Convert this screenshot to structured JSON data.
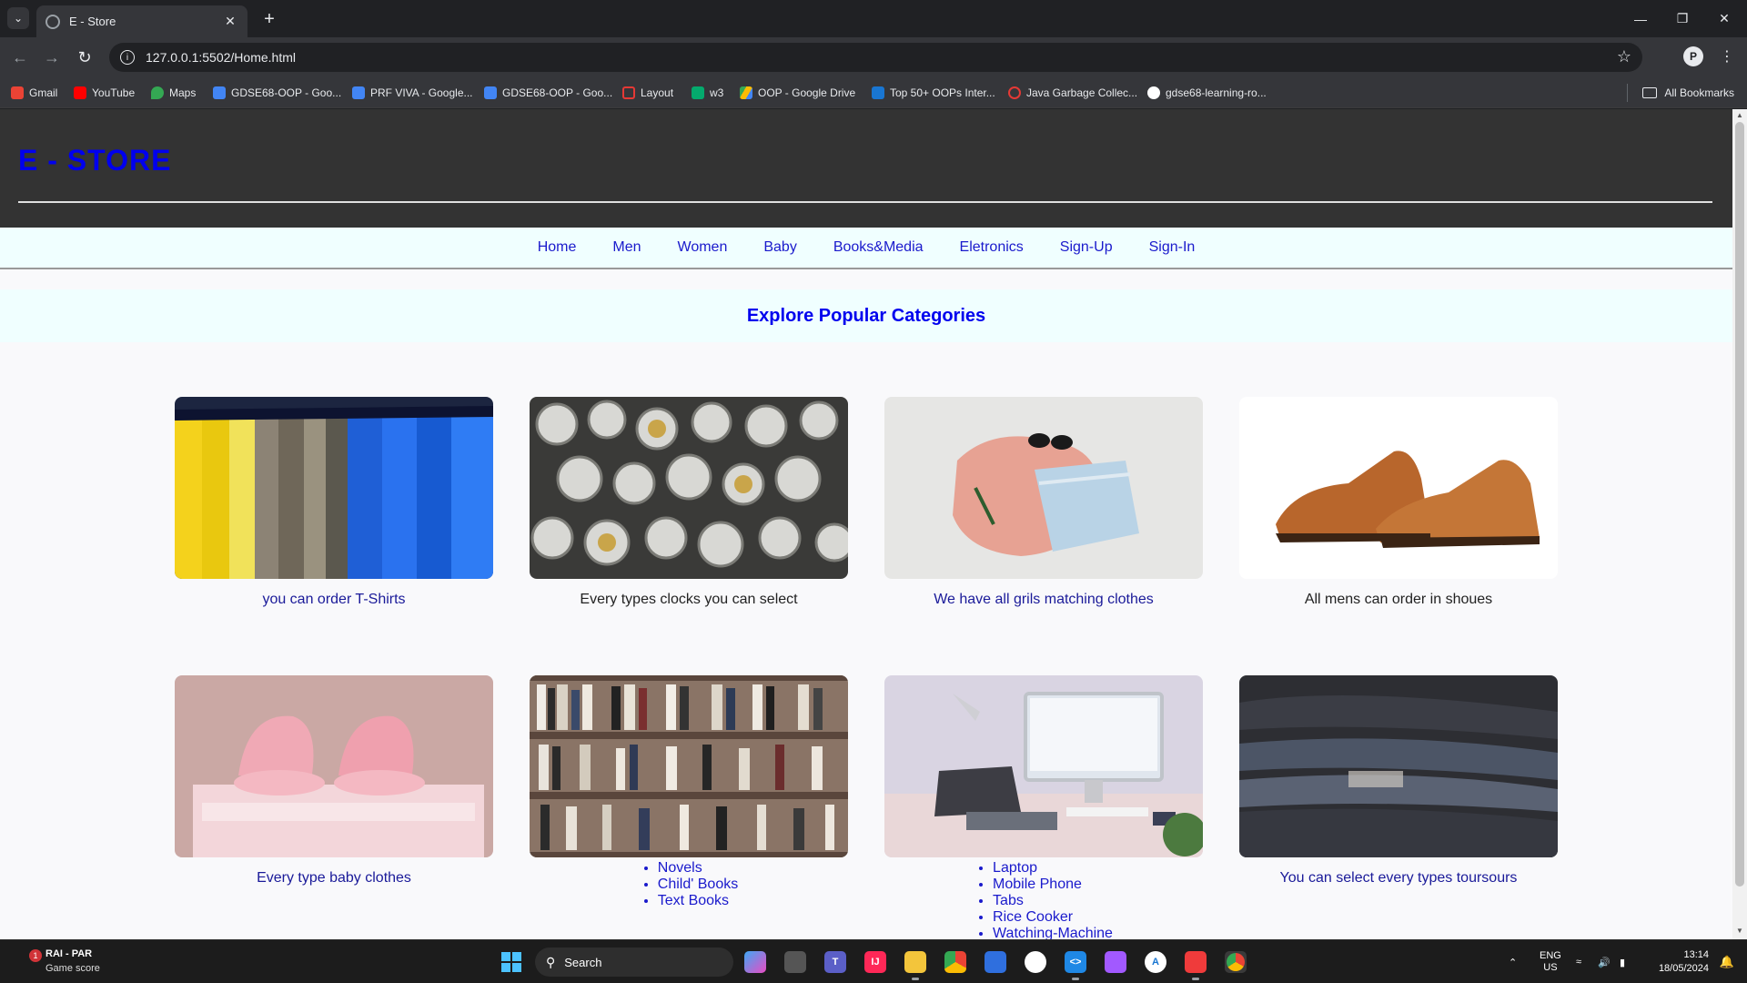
{
  "browser": {
    "tab_title": "E - Store",
    "url": "127.0.0.1:5502/Home.html",
    "bookmarks": [
      {
        "label": "Gmail",
        "color": "#ea4335"
      },
      {
        "label": "YouTube",
        "color": "#ff0000"
      },
      {
        "label": "Maps",
        "color": "#34a853"
      },
      {
        "label": "GDSE68-OOP - Goo...",
        "color": "#4285f4"
      },
      {
        "label": "PRF VIVA - Google...",
        "color": "#4285f4"
      },
      {
        "label": "GDSE68-OOP - Goo...",
        "color": "#4285f4"
      },
      {
        "label": "Layout",
        "color": "#e53935"
      },
      {
        "label": "w3",
        "color": "#04aa6d"
      },
      {
        "label": "OOP - Google Drive",
        "color": "#fbbc04"
      },
      {
        "label": "Top 50+ OOPs Inter...",
        "color": "#1976d2"
      },
      {
        "label": "Java Garbage Collec...",
        "color": "#e53935"
      },
      {
        "label": "gdse68-learning-ro...",
        "color": "#ffffff"
      }
    ],
    "all_bookmarks": "All Bookmarks"
  },
  "site": {
    "logo": "E - STORE",
    "nav": [
      "Home",
      "Men",
      "Women",
      "Baby",
      "Books&Media",
      "Eletronics",
      "Sign-Up",
      "Sign-In"
    ],
    "explore_title": "Explore Popular Categories",
    "cards": [
      {
        "caption": "you can order T-Shirts",
        "image": "tshirts-rack"
      },
      {
        "caption": "Every types clocks you can select",
        "image": "watches-pile"
      },
      {
        "caption": "We have all grils matching clothes",
        "image": "womens-clothes-flatlay"
      },
      {
        "caption": "All mens can order in shoues",
        "image": "brown-brogue-shoes"
      },
      {
        "caption": "Every type baby clothes",
        "image": "pink-baby-booties"
      },
      {
        "list": [
          "Novels",
          "Child' Books",
          "Text Books"
        ],
        "image": "bookshelf"
      },
      {
        "list": [
          "Laptop",
          "Mobile Phone",
          "Tabs",
          "Rice Cooker",
          "Watching-Machine"
        ],
        "image": "desk-computer"
      },
      {
        "caption": "You can select every types toursours",
        "image": "jeans-stack"
      }
    ]
  },
  "taskbar": {
    "widget_badge": "1",
    "widget_title": "RAI - PAR",
    "widget_sub": "Game score",
    "search_label": "Search",
    "lang": "ENG",
    "region": "US",
    "time": "13:14",
    "date": "18/05/2024"
  }
}
